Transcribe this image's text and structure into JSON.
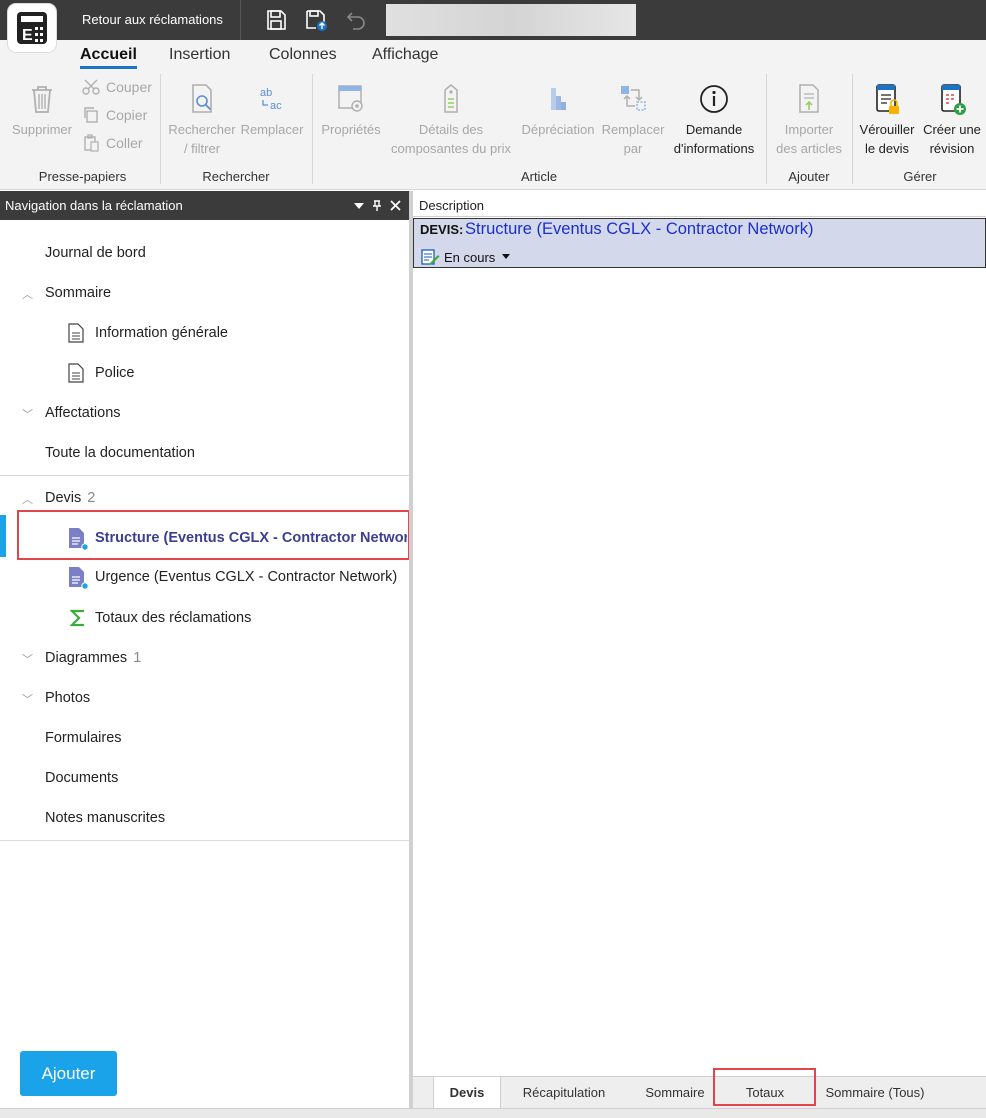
{
  "titlebar": {
    "back_label": "Retour aux réclamations"
  },
  "ribbon_tabs": [
    "Accueil",
    "Insertion",
    "Colonnes",
    "Affichage"
  ],
  "ribbon": {
    "delete": "Supprimer",
    "cut": "Couper",
    "copy": "Copier",
    "paste": "Coller",
    "clipboard_group": "Presse-papiers",
    "search_filter_1": "Rechercher",
    "search_filter_2": "/ filtrer",
    "replace": "Remplacer",
    "search_group": "Rechercher",
    "properties": "Propriétés",
    "price_details_1": "Détails des",
    "price_details_2": "composantes du prix",
    "depreciation": "Dépréciation",
    "replace_by_1": "Remplacer",
    "replace_by_2": "par",
    "info_request_1": "Demande",
    "info_request_2": "d'informations",
    "article_group": "Article",
    "import_1": "Importer",
    "import_2": "des articles",
    "add_group": "Ajouter",
    "lock_1": "Vérouiller",
    "lock_2": "le devis",
    "revision_1": "Créer une",
    "revision_2": "révision",
    "manage_group": "Gérer"
  },
  "nav": {
    "header": "Navigation dans la réclamation",
    "logbook": "Journal de bord",
    "summary": "Sommaire",
    "general_info": "Information générale",
    "policy": "Police",
    "assignments": "Affectations",
    "all_docs": "Toute la documentation",
    "devis": "Devis",
    "devis_count": "2",
    "structure": "Structure (Eventus CGLX - Contractor Network)",
    "urgence": "Urgence (Eventus CGLX - Contractor Network)",
    "totals": "Totaux des réclamations",
    "diagrams": "Diagrammes",
    "diagrams_count": "1",
    "photos": "Photos",
    "forms": "Formulaires",
    "documents": "Documents",
    "notes": "Notes manuscrites",
    "add_button": "Ajouter"
  },
  "content": {
    "column_header": "Description",
    "devis_label": "DEVIS:",
    "devis_title": "Structure (Eventus CGLX - Contractor Network)",
    "status": "En cours"
  },
  "bottom_tabs": [
    "Devis",
    "Récapitulation",
    "Sommaire",
    "Totaux",
    "Sommaire (Tous)"
  ]
}
